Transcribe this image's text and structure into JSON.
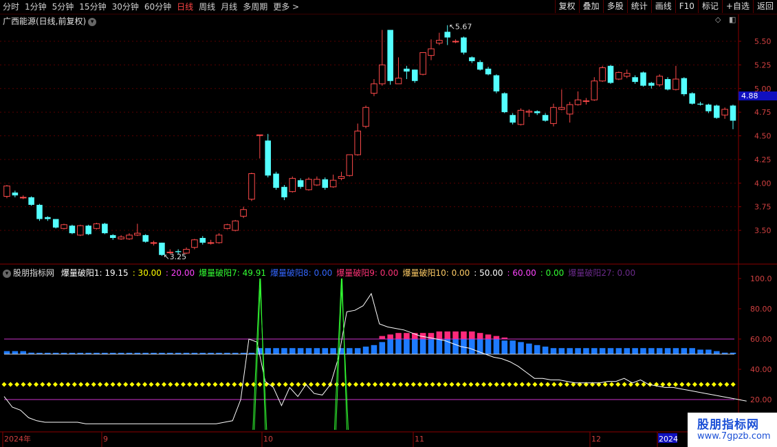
{
  "toolbar": {
    "tabs": [
      "分时",
      "1分钟",
      "5分钟",
      "15分钟",
      "30分钟",
      "60分钟",
      "日线",
      "周线",
      "月线",
      "多周期",
      "更多 >"
    ],
    "active_tab": "日线",
    "buttons": [
      "复权",
      "叠加",
      "多股",
      "统计",
      "画线",
      "F10",
      "标记",
      "+自选",
      "返回"
    ]
  },
  "price_panel": {
    "title": "广西能源(日线,前复权)",
    "y_ticks": [
      "5.50",
      "5.25",
      "5.00",
      "4.75",
      "4.50",
      "4.25",
      "4.00",
      "3.75",
      "3.50"
    ],
    "last_price": "4.88",
    "high_label": "5.67",
    "low_label": "3.25"
  },
  "indicator_panel": {
    "name": "股朋指标网",
    "legend": [
      {
        "text": "爆量破阳1: 19.15",
        "color": "#ffffff"
      },
      {
        "text": ": 30.00",
        "color": "#ffff00"
      },
      {
        "text": ": 20.00",
        "color": "#ff44ff"
      },
      {
        "text": "爆量破阳7: 49.91",
        "color": "#33ff33"
      },
      {
        "text": "爆量破阳8: 0.00",
        "color": "#3366ff"
      },
      {
        "text": "爆量破阳9: 0.00",
        "color": "#ff3377"
      },
      {
        "text": "爆量破阳10: 0.00",
        "color": "#ffcc66"
      },
      {
        "text": ": 50.00",
        "color": "#ffffff"
      },
      {
        "text": ": 60.00",
        "color": "#ff44ff"
      },
      {
        "text": ": 0.00",
        "color": "#33ff33"
      },
      {
        "text": "爆量破阳27: 0.00",
        "color": "#6a2a8a"
      }
    ],
    "y_ticks": [
      "100.0",
      "80.00",
      "60.00",
      "40.00",
      "20.00"
    ]
  },
  "x_axis": [
    "2024年",
    "9",
    "10",
    "11",
    "12",
    "2024"
  ],
  "watermark": {
    "line1": "股朋指标网",
    "line2": "www.7gpzb.com"
  },
  "chart_data": [
    {
      "type": "candlestick",
      "title": "广西能源(日线,前复权)",
      "ylim": [
        3.3,
        5.65
      ],
      "y_ticks": [
        3.5,
        3.75,
        4.0,
        4.25,
        4.5,
        4.75,
        5.0,
        5.25,
        5.5
      ],
      "candles": [
        [
          3.86,
          3.97,
          3.98,
          3.84
        ],
        [
          3.9,
          3.87,
          3.92,
          3.85
        ],
        [
          3.85,
          3.85,
          3.87,
          3.83
        ],
        [
          3.85,
          3.77,
          3.86,
          3.76
        ],
        [
          3.77,
          3.62,
          3.78,
          3.6
        ],
        [
          3.64,
          3.62,
          3.65,
          3.6
        ],
        [
          3.62,
          3.53,
          3.62,
          3.52
        ],
        [
          3.52,
          3.56,
          3.57,
          3.51
        ],
        [
          3.55,
          3.47,
          3.56,
          3.46
        ],
        [
          3.45,
          3.55,
          3.56,
          3.44
        ],
        [
          3.55,
          3.46,
          3.56,
          3.45
        ],
        [
          3.52,
          3.57,
          3.58,
          3.51
        ],
        [
          3.57,
          3.47,
          3.58,
          3.46
        ],
        [
          3.45,
          3.42,
          3.46,
          3.4
        ],
        [
          3.41,
          3.43,
          3.45,
          3.4
        ],
        [
          3.41,
          3.45,
          3.47,
          3.4
        ],
        [
          3.45,
          3.47,
          3.57,
          3.44
        ],
        [
          3.45,
          3.38,
          3.46,
          3.37
        ],
        [
          3.37,
          3.37,
          3.39,
          3.34
        ],
        [
          3.37,
          3.24,
          3.37,
          3.23
        ],
        [
          3.27,
          3.27,
          3.3,
          3.25
        ],
        [
          3.28,
          3.27,
          3.3,
          3.25
        ],
        [
          3.26,
          3.3,
          3.32,
          3.25
        ],
        [
          3.32,
          3.4,
          3.41,
          3.3
        ],
        [
          3.42,
          3.37,
          3.44,
          3.35
        ],
        [
          3.37,
          3.37,
          3.4,
          3.35
        ],
        [
          3.37,
          3.45,
          3.47,
          3.36
        ],
        [
          3.52,
          3.56,
          3.57,
          3.51
        ],
        [
          3.5,
          3.6,
          3.61,
          3.49
        ],
        [
          3.65,
          3.72,
          3.75,
          3.63
        ],
        [
          3.83,
          4.1,
          4.11,
          3.81
        ],
        [
          4.51,
          4.51,
          4.51,
          4.26
        ],
        [
          4.45,
          4.08,
          4.52,
          4.06
        ],
        [
          4.1,
          3.95,
          4.12,
          3.93
        ],
        [
          3.96,
          3.85,
          3.98,
          3.82
        ],
        [
          3.91,
          4.05,
          4.07,
          3.9
        ],
        [
          4.03,
          3.96,
          4.05,
          3.94
        ],
        [
          3.93,
          4.04,
          4.06,
          3.92
        ],
        [
          3.98,
          4.04,
          4.07,
          3.97
        ],
        [
          4.04,
          3.95,
          4.06,
          3.93
        ],
        [
          3.96,
          4.03,
          4.09,
          3.95
        ],
        [
          4.05,
          4.07,
          4.12,
          4.03
        ],
        [
          4.08,
          4.3,
          4.3,
          4.07
        ],
        [
          4.3,
          4.55,
          4.63,
          4.29
        ],
        [
          4.6,
          4.8,
          4.82,
          4.58
        ],
        [
          4.95,
          5.05,
          5.1,
          4.92
        ],
        [
          5.05,
          5.25,
          5.62,
          5.03
        ],
        [
          5.62,
          5.08,
          5.62,
          5.04
        ],
        [
          5.05,
          5.11,
          5.33,
          5.05
        ],
        [
          5.21,
          5.18,
          5.24,
          5.1
        ],
        [
          5.2,
          5.08,
          5.2,
          5.06
        ],
        [
          5.15,
          5.38,
          5.38,
          5.14
        ],
        [
          5.35,
          5.42,
          5.52,
          5.3
        ],
        [
          5.48,
          5.51,
          5.59,
          5.46
        ],
        [
          5.6,
          5.54,
          5.67,
          5.46
        ],
        [
          5.5,
          5.5,
          5.52,
          5.48
        ],
        [
          5.54,
          5.38,
          5.55,
          5.36
        ],
        [
          5.33,
          5.29,
          5.34,
          5.27
        ],
        [
          5.28,
          5.2,
          5.3,
          5.19
        ],
        [
          5.21,
          5.15,
          5.23,
          5.14
        ],
        [
          5.14,
          4.97,
          5.15,
          4.95
        ],
        [
          4.95,
          4.75,
          4.96,
          4.74
        ],
        [
          4.72,
          4.64,
          4.74,
          4.62
        ],
        [
          4.62,
          4.77,
          4.79,
          4.61
        ],
        [
          4.75,
          4.76,
          4.78,
          4.7
        ],
        [
          4.76,
          4.74,
          4.77,
          4.72
        ],
        [
          4.72,
          4.66,
          4.74,
          4.65
        ],
        [
          4.63,
          4.8,
          4.84,
          4.6
        ],
        [
          4.78,
          4.8,
          4.99,
          4.77
        ],
        [
          4.73,
          4.83,
          4.86,
          4.64
        ],
        [
          4.83,
          4.88,
          4.97,
          4.82
        ],
        [
          4.87,
          4.87,
          4.9,
          4.83
        ],
        [
          4.88,
          5.08,
          5.12,
          4.87
        ],
        [
          5.08,
          5.22,
          5.24,
          5.07
        ],
        [
          5.24,
          5.06,
          5.25,
          5.05
        ],
        [
          5.1,
          5.17,
          5.18,
          5.09
        ],
        [
          5.13,
          5.16,
          5.2,
          5.11
        ],
        [
          5.12,
          5.07,
          5.14,
          5.05
        ],
        [
          5.17,
          5.03,
          5.18,
          5.02
        ],
        [
          5.06,
          5.03,
          5.07,
          5.0
        ],
        [
          5.04,
          5.13,
          5.15,
          5.02
        ],
        [
          5.1,
          4.99,
          5.12,
          4.98
        ],
        [
          4.99,
          5.1,
          5.24,
          4.98
        ],
        [
          5.11,
          4.94,
          5.12,
          4.92
        ],
        [
          4.95,
          4.84,
          4.96,
          4.83
        ],
        [
          4.84,
          4.83,
          4.86,
          4.82
        ],
        [
          4.83,
          4.76,
          4.84,
          4.74
        ],
        [
          4.82,
          4.69,
          4.83,
          4.68
        ],
        [
          4.72,
          4.78,
          4.8,
          4.68
        ],
        [
          4.82,
          4.66,
          4.83,
          4.57
        ]
      ]
    },
    {
      "type": "bar+line",
      "ylim": [
        0,
        108
      ],
      "y_ticks": [
        20,
        40,
        60,
        80,
        100
      ],
      "hlines": [
        {
          "value": 60,
          "color": "#cc33cc"
        },
        {
          "value": 50,
          "color": "#cccccc"
        },
        {
          "value": 30,
          "color": "#ffff00",
          "style": "dots"
        },
        {
          "value": 20,
          "color": "#cc33cc"
        }
      ],
      "blue_bars": [
        52,
        52,
        52,
        51,
        50,
        50,
        50,
        50,
        50,
        50,
        50,
        50,
        50,
        50,
        50,
        50,
        50,
        50,
        50,
        50,
        50,
        50,
        50,
        50,
        50,
        50,
        50,
        50,
        50,
        50,
        50,
        54,
        54,
        54,
        54,
        54,
        54,
        54,
        54,
        54,
        54,
        54,
        54,
        54,
        55,
        56,
        58,
        60,
        60,
        60,
        60,
        60,
        60,
        60,
        60,
        60,
        60,
        60,
        60,
        60,
        60,
        59,
        59,
        58,
        57,
        56,
        55,
        54,
        54,
        54,
        54,
        54,
        54,
        54,
        54,
        54,
        54,
        54,
        54,
        54,
        54,
        54,
        54,
        54,
        54,
        53,
        53,
        52,
        51,
        51
      ],
      "pink_tops": [
        0,
        0,
        0,
        0,
        0,
        0,
        0,
        0,
        0,
        0,
        0,
        0,
        0,
        0,
        0,
        0,
        0,
        0,
        0,
        0,
        0,
        0,
        0,
        0,
        0,
        0,
        0,
        0,
        0,
        0,
        0,
        0,
        0,
        0,
        0,
        0,
        0,
        0,
        0,
        0,
        0,
        0,
        0,
        0,
        0,
        0,
        62,
        63,
        64,
        64,
        64,
        64,
        64,
        65,
        65,
        65,
        65,
        65,
        64,
        63,
        62,
        61,
        60,
        0,
        0,
        0,
        0,
        0,
        0,
        0,
        0,
        0,
        0,
        0,
        0,
        0,
        0,
        0,
        0,
        0,
        0,
        0,
        0,
        0,
        0,
        0,
        0,
        0,
        0
      ],
      "white_line": [
        22,
        15,
        13,
        8,
        6,
        5,
        5,
        5,
        5,
        5,
        4,
        4,
        4,
        4,
        4,
        4,
        4,
        4,
        4,
        4,
        4,
        4,
        4,
        4,
        4,
        4,
        4,
        5,
        6,
        20,
        60,
        58,
        32,
        28,
        16,
        28,
        22,
        30,
        24,
        23,
        30,
        48,
        78,
        79,
        82,
        90,
        70,
        68,
        67,
        66,
        64,
        62,
        61,
        60,
        59,
        57,
        55,
        54,
        52,
        50,
        48,
        47,
        45,
        42,
        38,
        34,
        34,
        33,
        33,
        32,
        31,
        31,
        31,
        31,
        32,
        32,
        34,
        31,
        33,
        30,
        29,
        28,
        28,
        27,
        26,
        25,
        24,
        23,
        22,
        21,
        20,
        19
      ],
      "green_spikes": [
        {
          "index": 31,
          "value": 100
        },
        {
          "index": 41,
          "value": 100
        }
      ]
    }
  ]
}
